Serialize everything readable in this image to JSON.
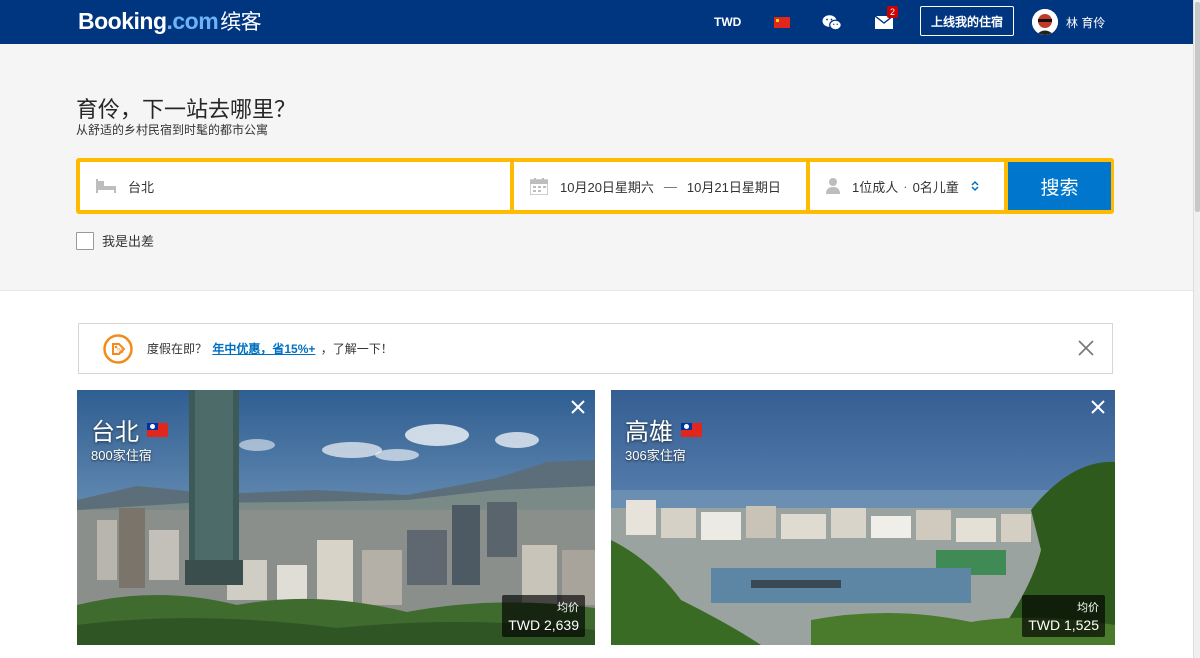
{
  "header": {
    "logo_main": "Booking",
    "logo_dot": ".com",
    "logo_cn": "缤客",
    "currency": "TWD",
    "mail_badge": "2",
    "list_property_label": "上线我的住宿",
    "username": "林 育伶"
  },
  "hero": {
    "title": "育伶，下一站去哪里？",
    "subtitle": "从舒适的乡村民宿到时髦的都市公寓"
  },
  "search": {
    "destination": "台北",
    "checkin": "10月20日星期六",
    "date_separator": "—",
    "checkout": "10月21日星期日",
    "adults": "1位成人",
    "guest_sep": "·",
    "children": "0名儿童",
    "button_label": "搜索",
    "business_trip_label": "我是出差"
  },
  "promo": {
    "prefix": "度假在即？",
    "link": "年中优惠，省15%+",
    "suffix": "，了解一下！"
  },
  "cards": [
    {
      "city": "台北",
      "count": "800家住宿",
      "price_label": "均价",
      "price": "TWD 2,639"
    },
    {
      "city": "高雄",
      "count": "306家住宿",
      "price_label": "均价",
      "price": "TWD 1,525"
    }
  ],
  "colors": {
    "brand_blue": "#003580",
    "search_yellow": "#febb02",
    "search_button": "#0077cc"
  }
}
